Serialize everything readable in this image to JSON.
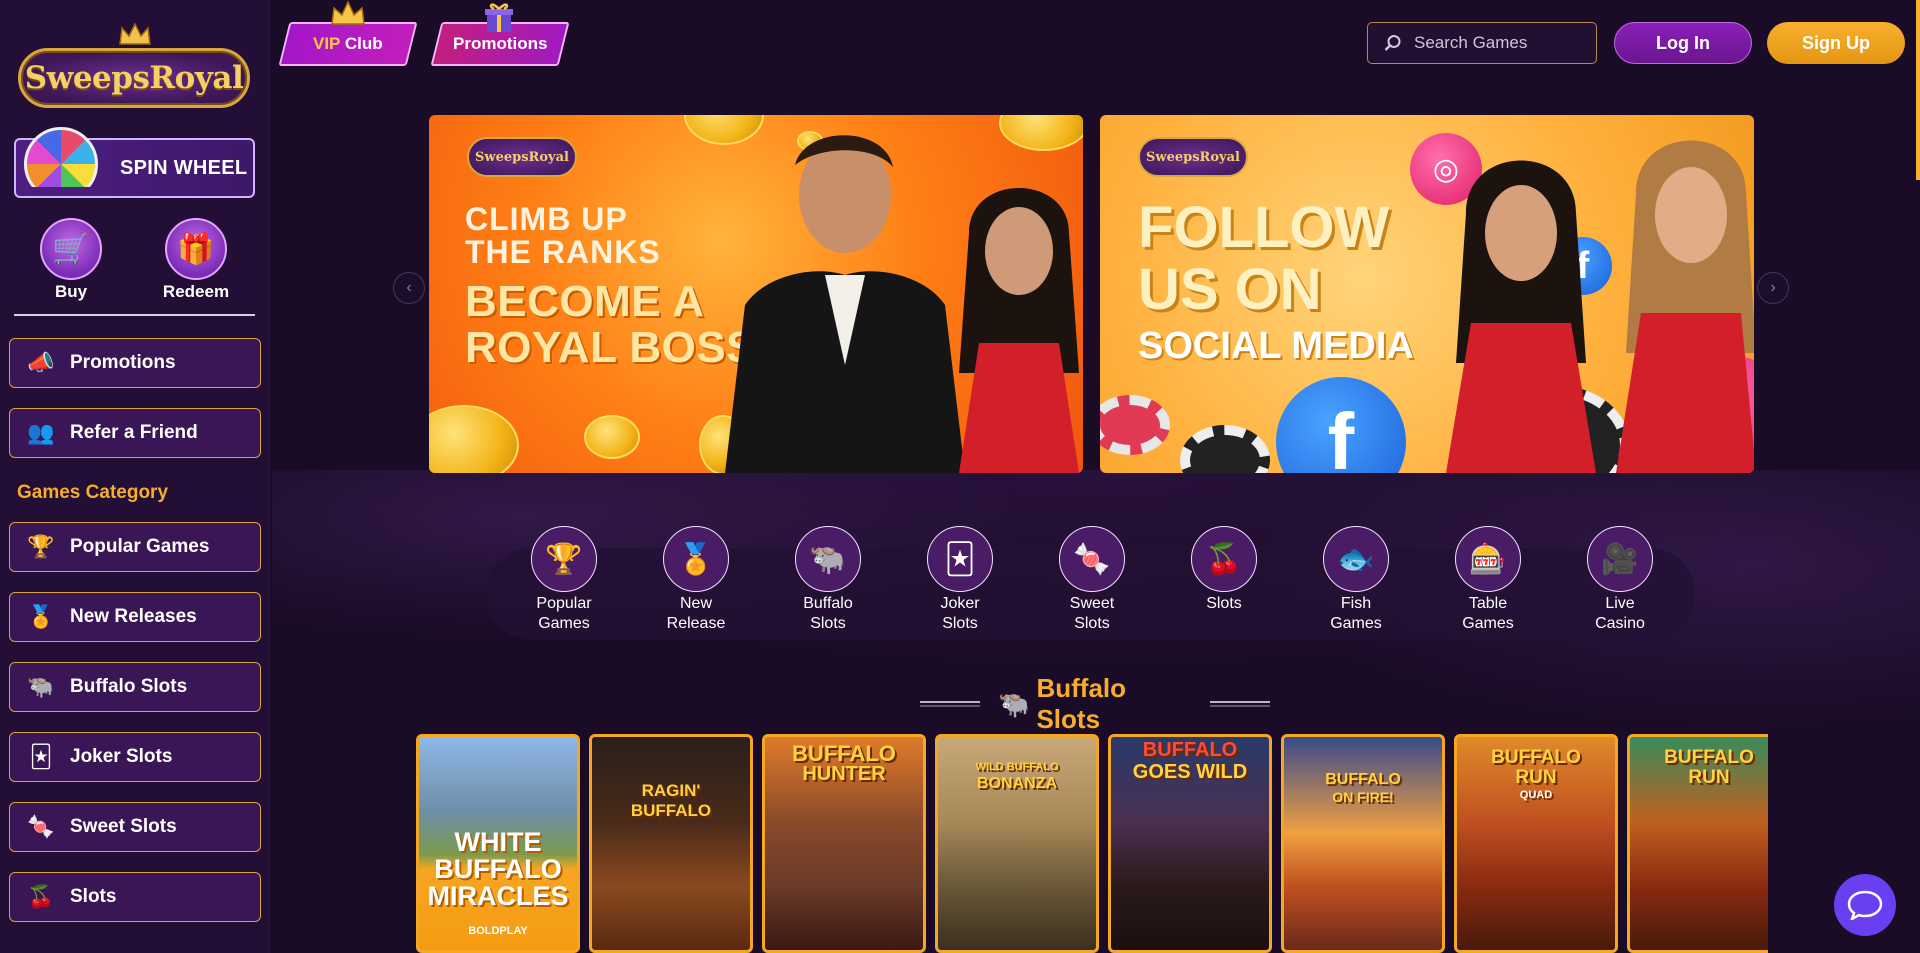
{
  "brand": {
    "logo_text": "SweepsRoyal",
    "banner_logo": "SweepsRoyal",
    "accent": "#f7ad2b",
    "purple": "#3a1656"
  },
  "sidebar": {
    "spin_wheel": "SPIN WHEEL",
    "buy": "Buy",
    "redeem": "Redeem",
    "promotions": "Promotions",
    "refer": "Refer a Friend",
    "category_heading": "Games Category",
    "categories": [
      {
        "label": "Popular Games",
        "icon": "trophy-icon"
      },
      {
        "label": "New Releases",
        "icon": "new-badge-icon"
      },
      {
        "label": "Buffalo Slots",
        "icon": "buffalo-icon"
      },
      {
        "label": "Joker Slots",
        "icon": "joker-icon"
      },
      {
        "label": "Sweet Slots",
        "icon": "candy-icon"
      },
      {
        "label": "Slots",
        "icon": "cherry-icon"
      }
    ]
  },
  "topbar": {
    "vip_prefix": "VIP",
    "vip_suffix": " Club",
    "promotions": "Promotions",
    "search_placeholder": "Search Games",
    "login": "Log In",
    "signup": "Sign Up"
  },
  "banners": [
    {
      "line1": "CLIMB UP",
      "line2": "THE RANKS",
      "line3": "BECOME A",
      "line4": "ROYAL BOSS"
    },
    {
      "line1": "FOLLOW",
      "line2": "US ON",
      "line3": "SOCIAL MEDIA"
    }
  ],
  "categories_strip": [
    {
      "line1": "Popular",
      "line2": "Games",
      "icon": "trophy-icon"
    },
    {
      "line1": "New",
      "line2": "Release",
      "icon": "new-badge-icon"
    },
    {
      "line1": "Buffalo",
      "line2": "Slots",
      "icon": "buffalo-icon"
    },
    {
      "line1": "Joker",
      "line2": "Slots",
      "icon": "joker-icon"
    },
    {
      "line1": "Sweet",
      "line2": "Slots",
      "icon": "candy-icon"
    },
    {
      "line1": "Slots",
      "line2": "",
      "icon": "cherry-icon"
    },
    {
      "line1": "Fish",
      "line2": "Games",
      "icon": "fish-icon"
    },
    {
      "line1": "Table",
      "line2": "Games",
      "icon": "table-icon"
    },
    {
      "line1": "Live",
      "line2": "Casino",
      "icon": "live-dealer-icon"
    }
  ],
  "section": {
    "title": "Buffalo Slots"
  },
  "games": [
    {
      "line1": "WHITE",
      "line2": "BUFFALO",
      "line3": "MIRACLES",
      "studio": "BOLDPLAY"
    },
    {
      "line1": "RAGIN'",
      "line2": "BUFFALO"
    },
    {
      "line1": "BUFFALO",
      "line2": "HUNTER"
    },
    {
      "line1": "WILD BUFFALO",
      "line2": "BONANZA"
    },
    {
      "line1": "BUFFALO",
      "line2": "GOES WILD"
    },
    {
      "line1": "BUFFALO",
      "line2": "ON FIRE!"
    },
    {
      "line1": "BUFFALO",
      "line2": "RUN",
      "line3": "QUAD"
    },
    {
      "line1": "BUFFALO",
      "line2": "RUN"
    }
  ]
}
